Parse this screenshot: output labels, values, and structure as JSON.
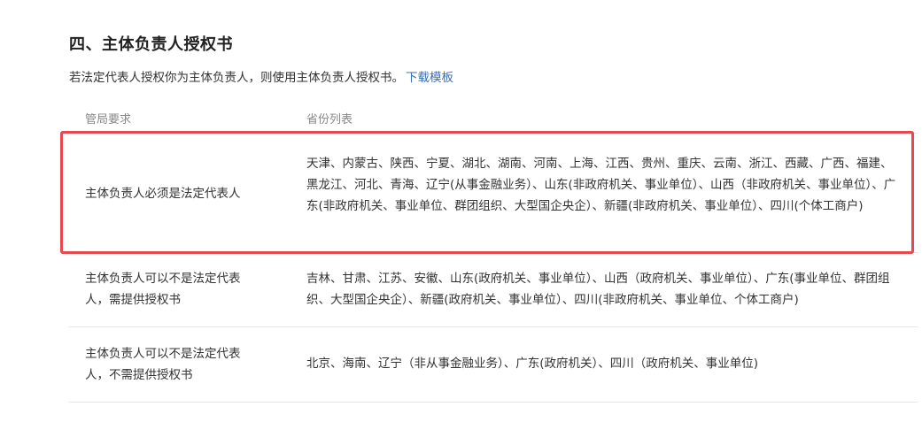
{
  "section": {
    "title": "四、主体负责人授权书",
    "description": "若法定代表人授权你为主体负责人，则使用主体负责人授权书。",
    "download_link": "下载模板"
  },
  "table": {
    "headers": {
      "requirement": "管局要求",
      "provinces": "省份列表"
    },
    "rows": [
      {
        "requirement": "主体负责人必须是法定代表人",
        "provinces": "天津、内蒙古、陕西、宁夏、湖北、湖南、河南、上海、江西、贵州、重庆、云南、浙江、西藏、广西、福建、黑龙江、河北、青海、辽宁(从事金融业务）、山东(非政府机关、事业单位）、山西（非政府机关、事业单位）、广东(非政府机关、事业单位、群团组织、大型国企央企）、新疆(非政府机关、事业单位）、四川(个体工商户)",
        "highlighted": true
      },
      {
        "requirement": "主体负责人可以不是法定代表人，需提供授权书",
        "provinces": "吉林、甘肃、江苏、安徽、山东(政府机关、事业单位）、山西（政府机关、事业单位）、广东(事业单位、群团组织、大型国企央企）、新疆(政府机关、事业单位）、四川(非政府机关、事业单位、个体工商户)",
        "highlighted": false
      },
      {
        "requirement": "主体负责人可以不是法定代表人，不需提供授权书",
        "provinces": "北京、海南、辽宁（非从事金融业务）、广东(政府机关）、四川（政府机关、事业单位)",
        "highlighted": false
      }
    ]
  },
  "colors": {
    "link": "#3a6fb5",
    "highlight_border": "#e5484d",
    "header_text": "#888888",
    "divider": "#e8e8e8"
  }
}
